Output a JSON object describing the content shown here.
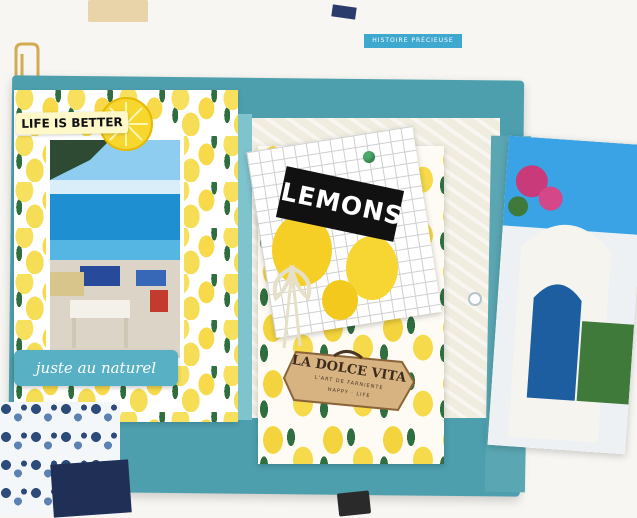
{
  "labels": {
    "tag_label": "HISTOIRE PRÉCIEUSE",
    "life_is_better": "LIFE IS BETTER",
    "juste_au_naturel": "juste au naturel",
    "lemons": "LEMONS",
    "la_dolce_vita": "LA DOLCE VITA",
    "badge_subtitle": "L'ART DE FARNIENTE",
    "badge_subtitle_2": "HAPPY · LIFE"
  },
  "colors": {
    "album_teal": "#4d9fae",
    "lemon_yellow": "#f5c518",
    "label_blue": "#58b0c4",
    "tag_blue": "#3fa8cf"
  }
}
